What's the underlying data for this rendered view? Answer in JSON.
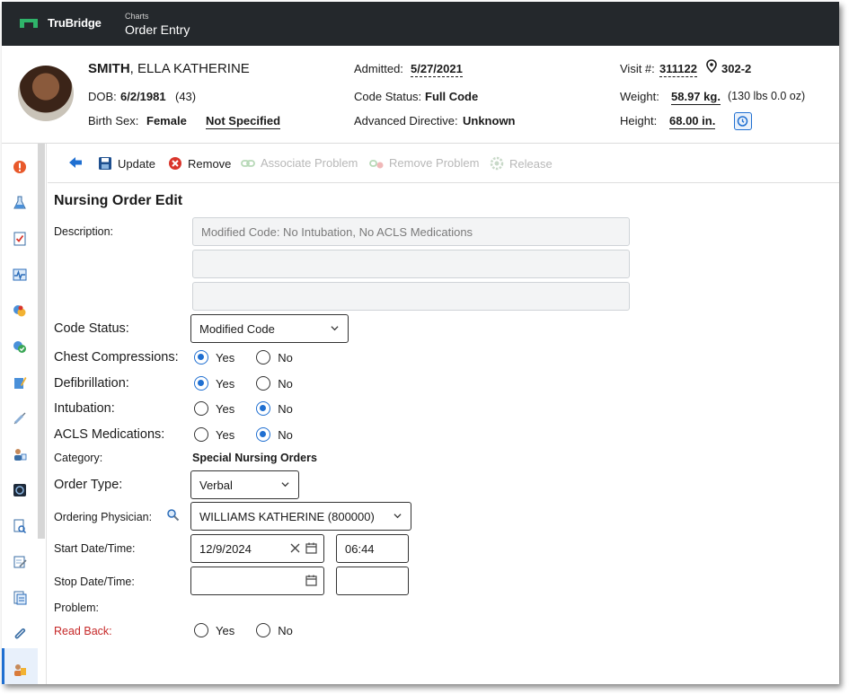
{
  "header": {
    "brand": "TruBridge",
    "section": "Charts",
    "title": "Order Entry"
  },
  "patient": {
    "last_name": "SMITH",
    "first_names": ", ELLA KATHERINE",
    "dob_label": "DOB:",
    "dob": "6/2/1981",
    "age": "(43)",
    "birth_sex_label": "Birth Sex:",
    "birth_sex": "Female",
    "gender": "Not Specified",
    "admitted_label": "Admitted:",
    "admitted": "5/27/2021",
    "code_status_label": "Code Status:",
    "code_status": "Full Code",
    "adv_directive_label": "Advanced Directive:",
    "adv_directive": "Unknown",
    "visit_label": "Visit #:",
    "visit": "311122",
    "room": "302-2",
    "weight_label": "Weight:",
    "weight": "58.97 kg.",
    "weight_alt": "(130 lbs 0.0 oz)",
    "height_label": "Height:",
    "height": "68.00 in."
  },
  "toolbar": {
    "update": "Update",
    "remove": "Remove",
    "associate_problem": "Associate Problem",
    "remove_problem": "Remove Problem",
    "release": "Release"
  },
  "form": {
    "title": "Nursing Order Edit",
    "description_label": "Description:",
    "description_1": "Modified Code: No Intubation, No ACLS Medications",
    "description_2": "",
    "description_3": "",
    "code_status_label": "Code Status:",
    "code_status_value": "Modified Code",
    "chest_label": "Chest Compressions:",
    "defib_label": "Defibrillation:",
    "intubation_label": "Intubation:",
    "acls_label": "ACLS Medications:",
    "yes": "Yes",
    "no": "No",
    "category_label": "Category:",
    "category_value": "Special Nursing Orders",
    "order_type_label": "Order Type:",
    "order_type_value": "Verbal",
    "physician_label": "Ordering Physician:",
    "physician_value": "WILLIAMS KATHERINE (800000)",
    "start_label": "Start Date/Time:",
    "start_date": "12/9/2024",
    "start_time": "06:44",
    "stop_label": "Stop Date/Time:",
    "stop_date": "",
    "stop_time": "",
    "problem_label": "Problem:",
    "read_back_label": "Read Back:"
  },
  "colors": {
    "topbar": "#24282c",
    "accent": "#1f6fd1",
    "brand_green": "#2fb36a",
    "required_red": "#c62828"
  }
}
